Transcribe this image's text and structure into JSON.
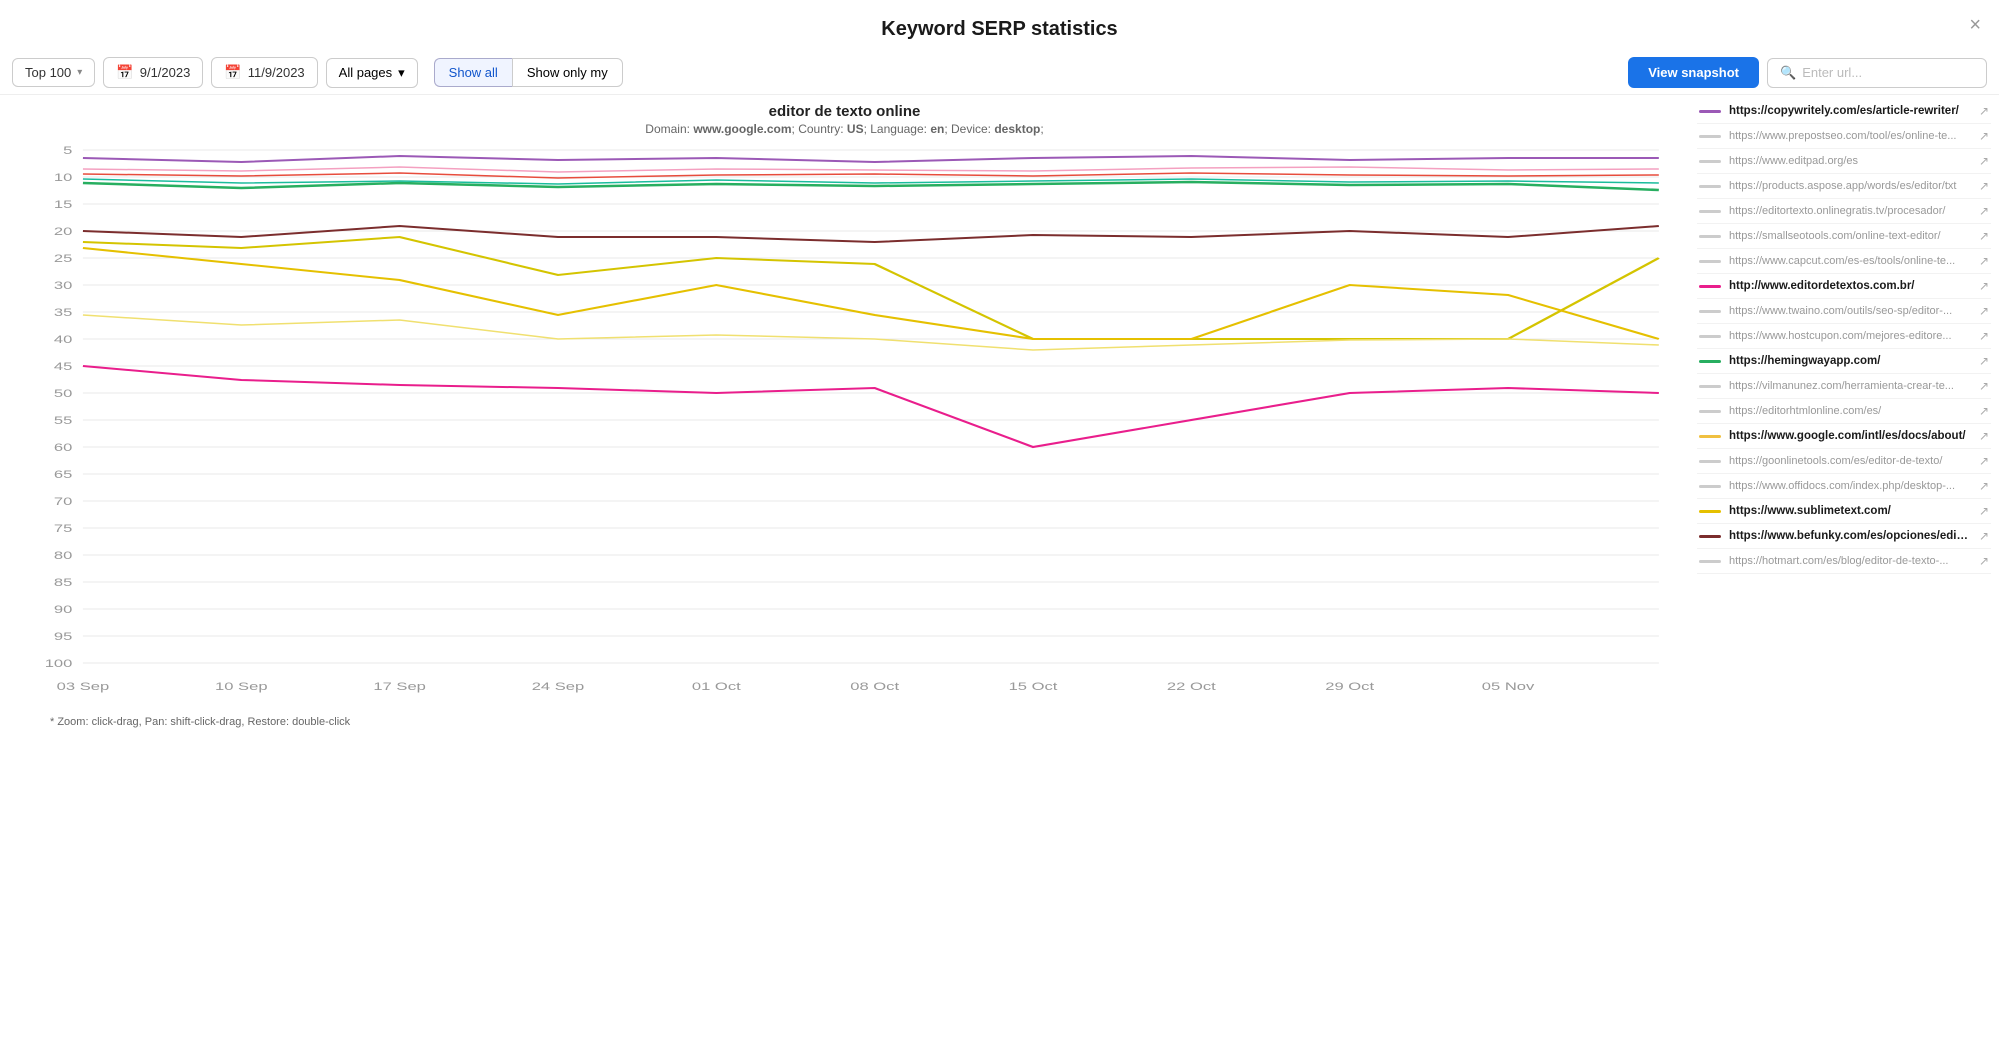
{
  "header": {
    "title": "Keyword SERP statistics",
    "close_label": "×"
  },
  "toolbar": {
    "top_label": "Top 100",
    "date_start": "9/1/2023",
    "date_end": "11/9/2023",
    "pages_label": "All pages",
    "show_all_label": "Show all",
    "show_only_my_label": "Show only my",
    "view_snapshot_label": "View snapshot",
    "search_placeholder": "Enter url..."
  },
  "chart": {
    "title": "editor de texto online",
    "meta": "Domain: www.google.com; Country: US; Language: en; Device: desktop;",
    "meta_parts": {
      "domain": "www.google.com",
      "country": "US",
      "language": "en",
      "device": "desktop"
    },
    "zoom_hint": "* Zoom: click-drag, Pan: shift-click-drag, Restore: double-click",
    "x_labels": [
      "03 Sep",
      "10 Sep",
      "17 Sep",
      "24 Sep",
      "01 Oct",
      "08 Oct",
      "15 Oct",
      "22 Oct",
      "29 Oct",
      "05 Nov"
    ],
    "y_labels": [
      "5",
      "10",
      "15",
      "20",
      "25",
      "30",
      "35",
      "40",
      "45",
      "50",
      "55",
      "60",
      "65",
      "70",
      "75",
      "80",
      "85",
      "90",
      "95",
      "100"
    ]
  },
  "legend": [
    {
      "url": "https://copywritely.com/es/article-rewriter/",
      "color": "#9b59b6",
      "highlighted": true
    },
    {
      "url": "https://www.prepostseo.com/tool/es/online-te...",
      "color": "#cccccc",
      "highlighted": false
    },
    {
      "url": "https://www.editpad.org/es",
      "color": "#cccccc",
      "highlighted": false
    },
    {
      "url": "https://products.aspose.app/words/es/editor/txt",
      "color": "#cccccc",
      "highlighted": false
    },
    {
      "url": "https://editortexto.onlinegratis.tv/procesador/",
      "color": "#cccccc",
      "highlighted": false
    },
    {
      "url": "https://smallseotools.com/online-text-editor/",
      "color": "#cccccc",
      "highlighted": false
    },
    {
      "url": "https://www.capcut.com/es-es/tools/online-te...",
      "color": "#cccccc",
      "highlighted": false
    },
    {
      "url": "http://www.editordetextos.com.br/",
      "color": "#e91e8c",
      "highlighted": true
    },
    {
      "url": "https://www.twaino.com/outils/seo-sp/editor-...",
      "color": "#cccccc",
      "highlighted": false
    },
    {
      "url": "https://www.hostcupon.com/mejores-editore...",
      "color": "#cccccc",
      "highlighted": false
    },
    {
      "url": "https://hemingwayapp.com/",
      "color": "#27ae60",
      "highlighted": true
    },
    {
      "url": "https://vilmanunez.com/herramienta-crear-te...",
      "color": "#cccccc",
      "highlighted": false
    },
    {
      "url": "https://editorhtmlonline.com/es/",
      "color": "#cccccc",
      "highlighted": false
    },
    {
      "url": "https://www.google.com/intl/es/docs/about/",
      "color": "#f0c040",
      "highlighted": true
    },
    {
      "url": "https://goonlinetools.com/es/editor-de-texto/",
      "color": "#cccccc",
      "highlighted": false
    },
    {
      "url": "https://www.offidocs.com/index.php/desktop-...",
      "color": "#cccccc",
      "highlighted": false
    },
    {
      "url": "https://www.sublimetext.com/",
      "color": "#e5c000",
      "highlighted": true
    },
    {
      "url": "https://www.befunky.com/es/opciones/editor-...",
      "color": "#7b2d2d",
      "highlighted": true
    },
    {
      "url": "https://hotmart.com/es/blog/editor-de-texto-...",
      "color": "#cccccc",
      "highlighted": false
    }
  ]
}
